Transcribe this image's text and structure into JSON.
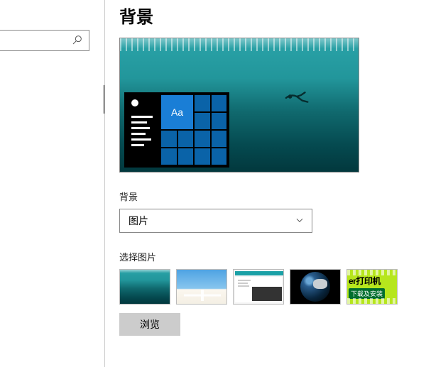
{
  "page_title": "背景",
  "search": {
    "placeholder": ""
  },
  "preview_tile_text": "Aa",
  "bg_section": {
    "label": "背景",
    "dropdown_value": "图片"
  },
  "choose_section": {
    "label": "选择图片",
    "browse_label": "浏览",
    "thumb5_line1": "er打印机",
    "thumb5_line2": "下载及安装"
  }
}
